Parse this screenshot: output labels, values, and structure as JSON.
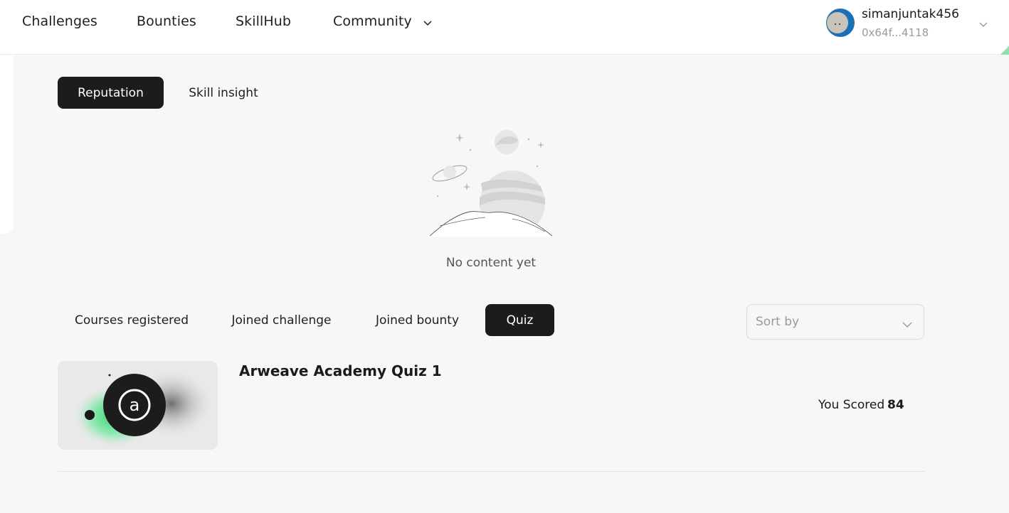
{
  "nav": {
    "challenges": "Challenges",
    "bounties": "Bounties",
    "skillhub": "SkillHub",
    "community": "Community"
  },
  "user": {
    "username": "simanjuntak456",
    "address": "0x64f...4118"
  },
  "profile_tabs": {
    "reputation": "Reputation",
    "skill_insight": "Skill insight"
  },
  "empty_state": {
    "text": "No content yet"
  },
  "activity_tabs": {
    "courses": "Courses registered",
    "challenge": "Joined challenge",
    "bounty": "Joined bounty",
    "quiz": "Quiz"
  },
  "sort": {
    "placeholder": "Sort by"
  },
  "quiz_item": {
    "title": "Arweave Academy Quiz 1",
    "score_label": "You Scored",
    "score_value": "84"
  },
  "colors": {
    "active_tab_bg": "#1c1c1c",
    "page_bg": "#f7f7f7",
    "accent_green": "#39d27a"
  },
  "icons": {
    "community_dropdown": "chevron-down-icon",
    "user_dropdown": "chevron-down-icon",
    "sort_dropdown": "chevron-down-icon",
    "quiz_logo": "arweave-logo-icon"
  }
}
